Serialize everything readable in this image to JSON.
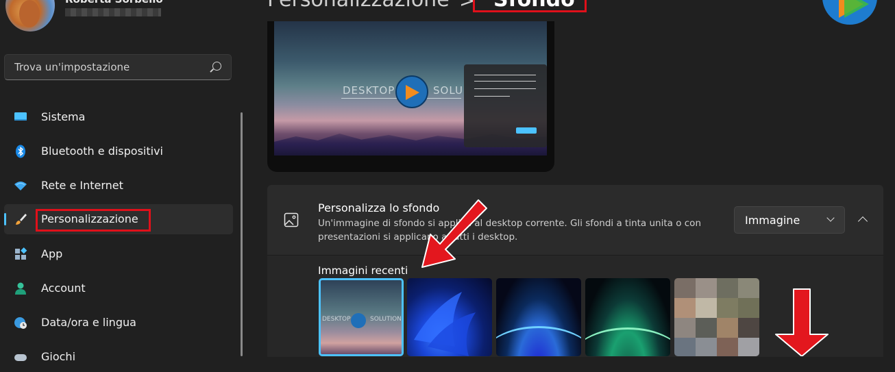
{
  "user": {
    "name": "Roberta Sorbello"
  },
  "search": {
    "placeholder": "Trova un'impostazione"
  },
  "nav": [
    {
      "label": "Sistema",
      "icon": "monitor-icon"
    },
    {
      "label": "Bluetooth e dispositivi",
      "icon": "bluetooth-icon"
    },
    {
      "label": "Rete e Internet",
      "icon": "wifi-icon"
    },
    {
      "label": "Personalizzazione",
      "icon": "paintbrush-icon",
      "active": true
    },
    {
      "label": "App",
      "icon": "apps-icon"
    },
    {
      "label": "Account",
      "icon": "person-icon"
    },
    {
      "label": "Data/ora e lingua",
      "icon": "globe-clock-icon"
    },
    {
      "label": "Giochi",
      "icon": "gamepad-icon"
    }
  ],
  "header": {
    "breadcrumb": "Personalizzazione",
    "separator": ">",
    "current": "Sfondo"
  },
  "preview": {
    "wallpaper_left_text": "DESKTOP",
    "wallpaper_right_text": "SOLU"
  },
  "background_card": {
    "title": "Personalizza lo sfondo",
    "description": "Un'immagine di sfondo si applica al desktop corrente. Gli sfondi a tinta unita o con presentazioni si applicano a tutti i desktop.",
    "dropdown_value": "Immagine"
  },
  "recent": {
    "label": "Immagini recenti",
    "thumb1_left_text": "DESKTOP",
    "thumb1_right_text": "SOLUTION"
  },
  "colors": {
    "accent": "#4cc2ff",
    "highlight_red": "#e0101a",
    "background": "#202020"
  }
}
